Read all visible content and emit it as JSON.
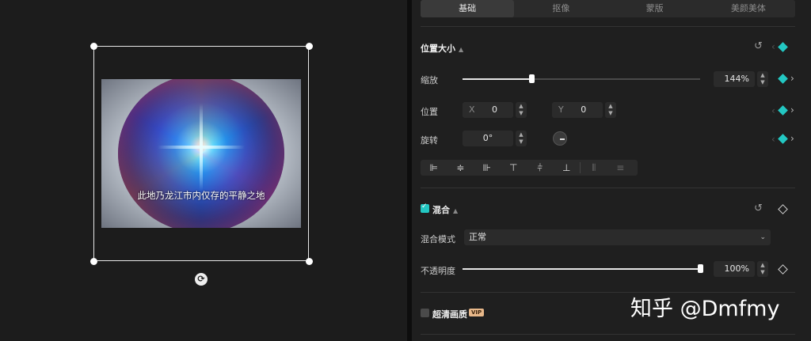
{
  "preview": {
    "subtitle": "此地乃龙江市内仅存的平静之地"
  },
  "tabs": [
    {
      "label": "基础",
      "active": true
    },
    {
      "label": "抠像",
      "active": false
    },
    {
      "label": "蒙版",
      "active": false
    },
    {
      "label": "美颜美体",
      "active": false
    }
  ],
  "position_size": {
    "title": "位置大小",
    "scale_label": "缩放",
    "scale_value": "144%",
    "scale_fraction": 0.29,
    "position_label": "位置",
    "x_label": "X",
    "x_value": "0",
    "y_label": "Y",
    "y_value": "0",
    "rotate_label": "旋转",
    "rotate_value": "0°"
  },
  "blend": {
    "title": "混合",
    "checked": true,
    "mode_label": "混合模式",
    "mode_value": "正常",
    "opacity_label": "不透明度",
    "opacity_value": "100%",
    "opacity_fraction": 1.0
  },
  "hd": {
    "title": "超清画质",
    "badge": "VIP",
    "checked": false
  },
  "watermark": "知乎 @Dmfmy",
  "colors": {
    "accent": "#23c7c2",
    "panel_bg": "#1f1f1f",
    "field_bg": "#2b2b2b"
  }
}
